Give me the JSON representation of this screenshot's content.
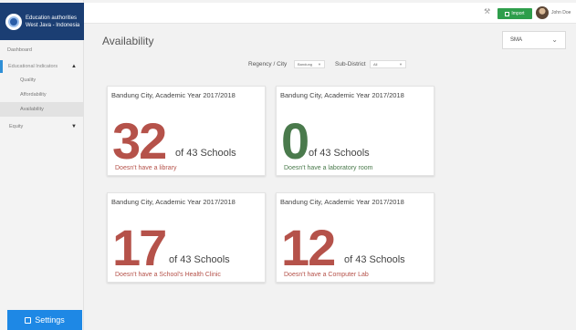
{
  "brand": {
    "line1": "Education authorities",
    "line2": "West Java - Indonesia"
  },
  "sidebar": {
    "dashboard": "Dashboard",
    "section": "Educational Indicators",
    "subitems": [
      "Quality",
      "Affordability",
      "Availability"
    ],
    "active": "Availability",
    "equity": "Equity",
    "settings": "Settings"
  },
  "topbar": {
    "import": "Import",
    "username": "John Doe"
  },
  "page": {
    "title": "Availability",
    "level_value": "SMA"
  },
  "filters": {
    "regency_label": "Regency / City",
    "regency_value": "Bandung",
    "subdistrict_label": "Sub-District",
    "subdistrict_value": "All"
  },
  "cards": [
    {
      "header": "Bandung City, Academic Year 2017/2018",
      "number": "32",
      "of_text": "of 43 Schools",
      "desc": "Doesn't have a library",
      "color": "#b5524a"
    },
    {
      "header": "Bandung City, Academic Year 2017/2018",
      "number": "0",
      "of_text": "of 43 Schools",
      "desc": "Doesn't have a laboratory room",
      "color": "#4a7a4c"
    },
    {
      "header": "Bandung City, Academic Year 2017/2018",
      "number": "17",
      "of_text": "of 43 Schools",
      "desc": "Doesn't have a School's Health Clinic",
      "color": "#b5524a"
    },
    {
      "header": "Bandung City, Academic Year 2017/2018",
      "number": "12",
      "of_text": "of 43 Schools",
      "desc": "Doesn't have a Computer Lab",
      "color": "#b5524a"
    }
  ],
  "colors": {
    "brand": "#1b3e73",
    "accent": "#1e88e5",
    "import": "#2e9e4b",
    "negative": "#b5524a",
    "positive": "#4a7a4c"
  }
}
